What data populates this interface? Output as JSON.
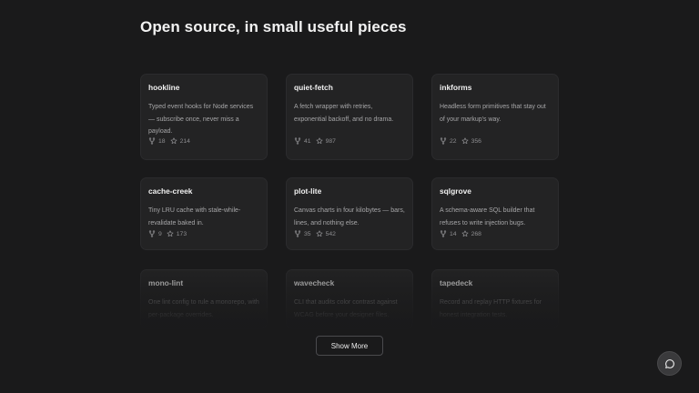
{
  "page": {
    "title": "Open source, in small useful pieces"
  },
  "cards": [
    {
      "name": "hookline",
      "description": "Typed event hooks for Node services — subscribe once, never miss a payload.",
      "forks": "18",
      "stars": "214"
    },
    {
      "name": "quiet-fetch",
      "description": "A fetch wrapper with retries, exponential backoff, and no drama.",
      "forks": "41",
      "stars": "987"
    },
    {
      "name": "inkforms",
      "description": "Headless form primitives that stay out of your markup's way.",
      "forks": "22",
      "stars": "356"
    },
    {
      "name": "cache-creek",
      "description": "Tiny LRU cache with stale-while-revalidate baked in.",
      "forks": "9",
      "stars": "173"
    },
    {
      "name": "plot-lite",
      "description": "Canvas charts in four kilobytes — bars, lines, and nothing else.",
      "forks": "35",
      "stars": "542"
    },
    {
      "name": "sqlgrove",
      "description": "A schema-aware SQL builder that refuses to write injection bugs.",
      "forks": "14",
      "stars": "268"
    },
    {
      "name": "mono-lint",
      "description": "One lint config to rule a monorepo, with per-package overrides.",
      "forks": "",
      "stars": ""
    },
    {
      "name": "wavecheck",
      "description": "CLI that audits color contrast against WCAG before your designer files.",
      "forks": "",
      "stars": ""
    },
    {
      "name": "tapedeck",
      "description": "Record and replay HTTP fixtures for honest integration tests.",
      "forks": "",
      "stars": ""
    }
  ],
  "actions": {
    "show_more_label": "Show More"
  },
  "icons": {
    "fork": "fork-icon",
    "star": "star-icon",
    "chat": "chat-bubble-icon"
  },
  "colors": {
    "background": "#1a1a1b",
    "card": "#232324",
    "text": "#f0f0f0",
    "muted": "#a6a6a8"
  }
}
